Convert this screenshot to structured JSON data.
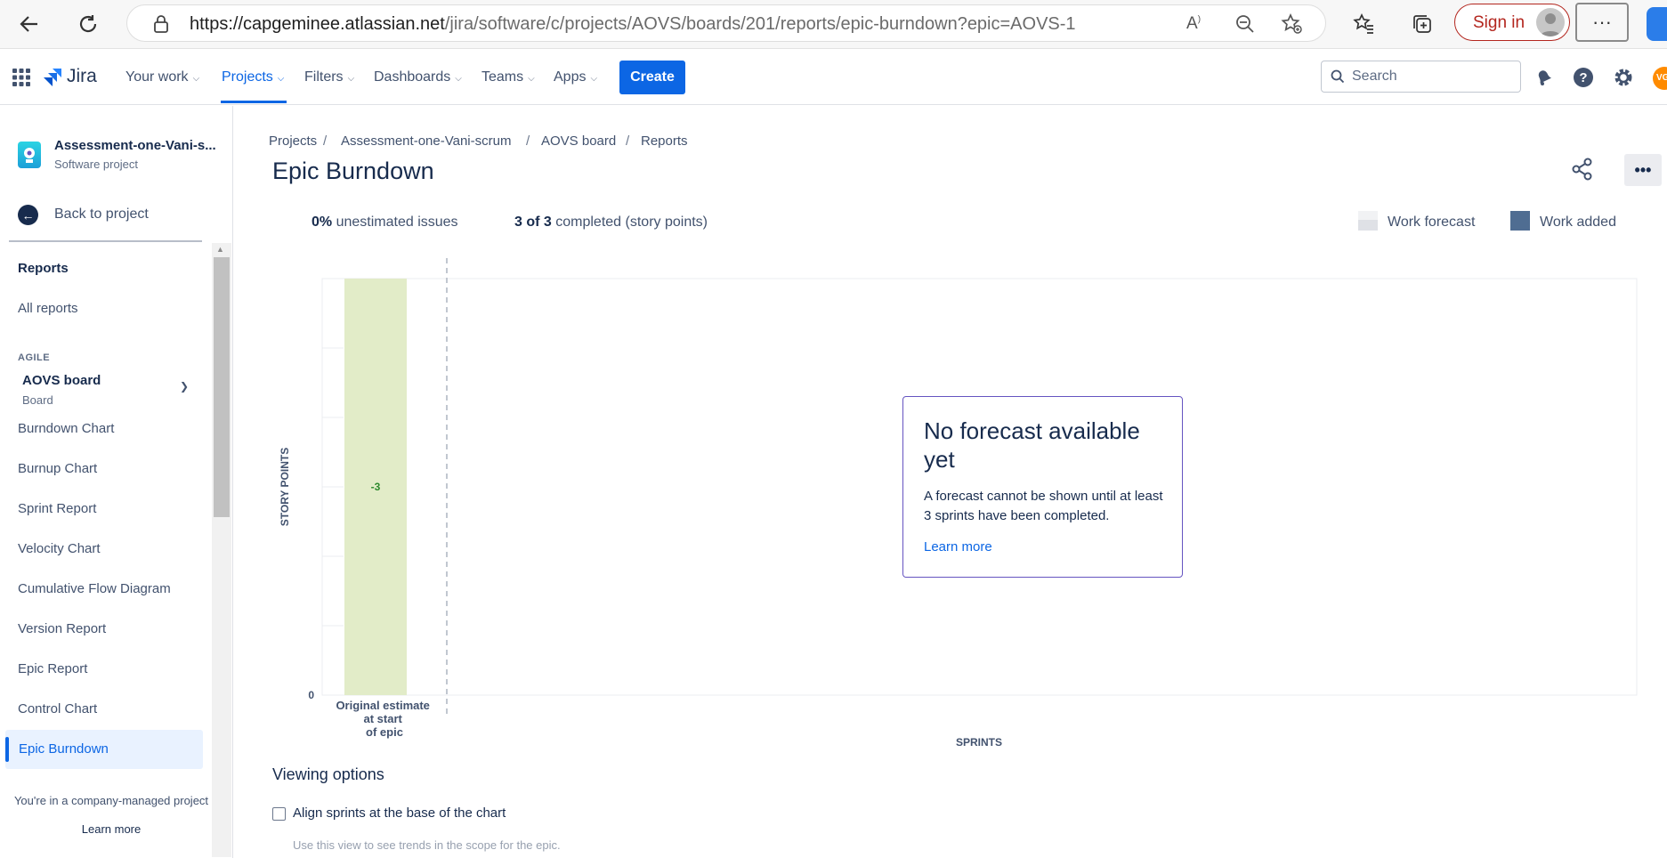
{
  "browser": {
    "url_main": "https://capgeminee.atlassian.net",
    "url_rest": "/jira/software/c/projects/AOVS/boards/201/reports/epic-burndown?epic=AOVS-1",
    "sign_in": "Sign in",
    "more": "···"
  },
  "topnav": {
    "logo": "Jira",
    "items": [
      "Your work",
      "Projects",
      "Filters",
      "Dashboards",
      "Teams",
      "Apps"
    ],
    "create": "Create",
    "search_placeholder": "Search",
    "avatar_initials": "VG"
  },
  "sidebar": {
    "project_name": "Assessment-one-Vani-s...",
    "project_type": "Software project",
    "back": "Back to project",
    "reports_heading": "Reports",
    "all_reports": "All reports",
    "section": "AGILE",
    "board_name": "AOVS board",
    "board_sub": "Board",
    "items": [
      "Burndown Chart",
      "Burnup Chart",
      "Sprint Report",
      "Velocity Chart",
      "Cumulative Flow Diagram",
      "Version Report",
      "Epic Report",
      "Control Chart",
      "Epic Burndown"
    ],
    "selected": "Epic Burndown",
    "footer_text": "You're in a company-managed project",
    "footer_link": "Learn more"
  },
  "breadcrumb": [
    "Projects",
    "Assessment-one-Vani-scrum",
    "AOVS board",
    "Reports"
  ],
  "page_title": "Epic Burndown",
  "stats": {
    "unestimated_value": "0%",
    "unestimated_label": "unestimated issues",
    "completed_value": "3 of 3",
    "completed_label": "completed (story points)"
  },
  "legend": {
    "forecast": "Work forecast",
    "added": "Work added",
    "forecast_color": "#dfe1e6",
    "added_color": "#4f6d92"
  },
  "chart_data": {
    "type": "bar",
    "ylabel": "STORY POINTS",
    "xlabel": "SPRINTS",
    "categories": [
      "Original estimate at start of epic"
    ],
    "values": [
      -3
    ],
    "bar_label": "-3",
    "y_tick": "0",
    "bar_color": "#e2ecc8",
    "label_color": "#2d8a2d"
  },
  "forecast_card": {
    "title": "No forecast available yet",
    "body": "A forecast cannot be shown until at least 3 sprints have been completed.",
    "link": "Learn more"
  },
  "viewing_options": {
    "title": "Viewing options",
    "checkbox_label": "Align sprints at the base of the chart",
    "checkbox_help": "Use this view to see trends in the scope for the epic."
  }
}
